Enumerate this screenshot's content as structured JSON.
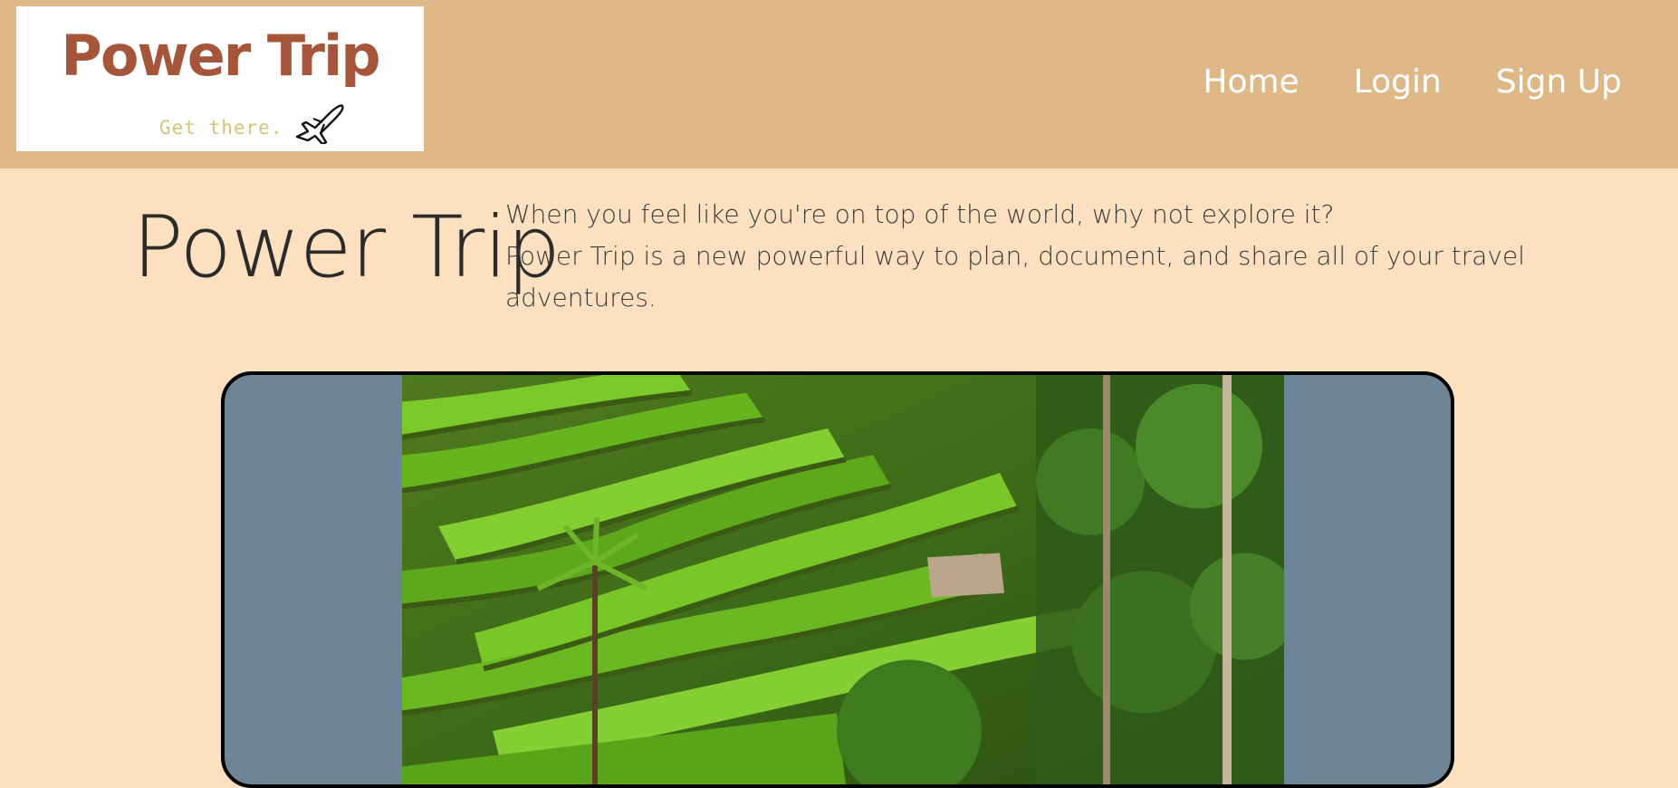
{
  "navbar": {
    "logo": {
      "title": "Power Trip",
      "tagline": "Get there."
    },
    "links": [
      {
        "label": "Home"
      },
      {
        "label": "Login"
      },
      {
        "label": "Sign Up"
      }
    ],
    "background": "#dfb888"
  },
  "hero": {
    "title": "Power Trip",
    "line1": "When you feel like you're on top of the world, why not explore it?",
    "line2": "Power Trip is a new powerful way to plan, document, and share all of your travel adventures."
  },
  "carousel": {
    "background": "#6d8595",
    "image_subject": "rice-terraces-photo"
  },
  "colors": {
    "page_background": "#fde0bf",
    "logo_title": "#a4553a",
    "tagline": "#d8c27a"
  }
}
